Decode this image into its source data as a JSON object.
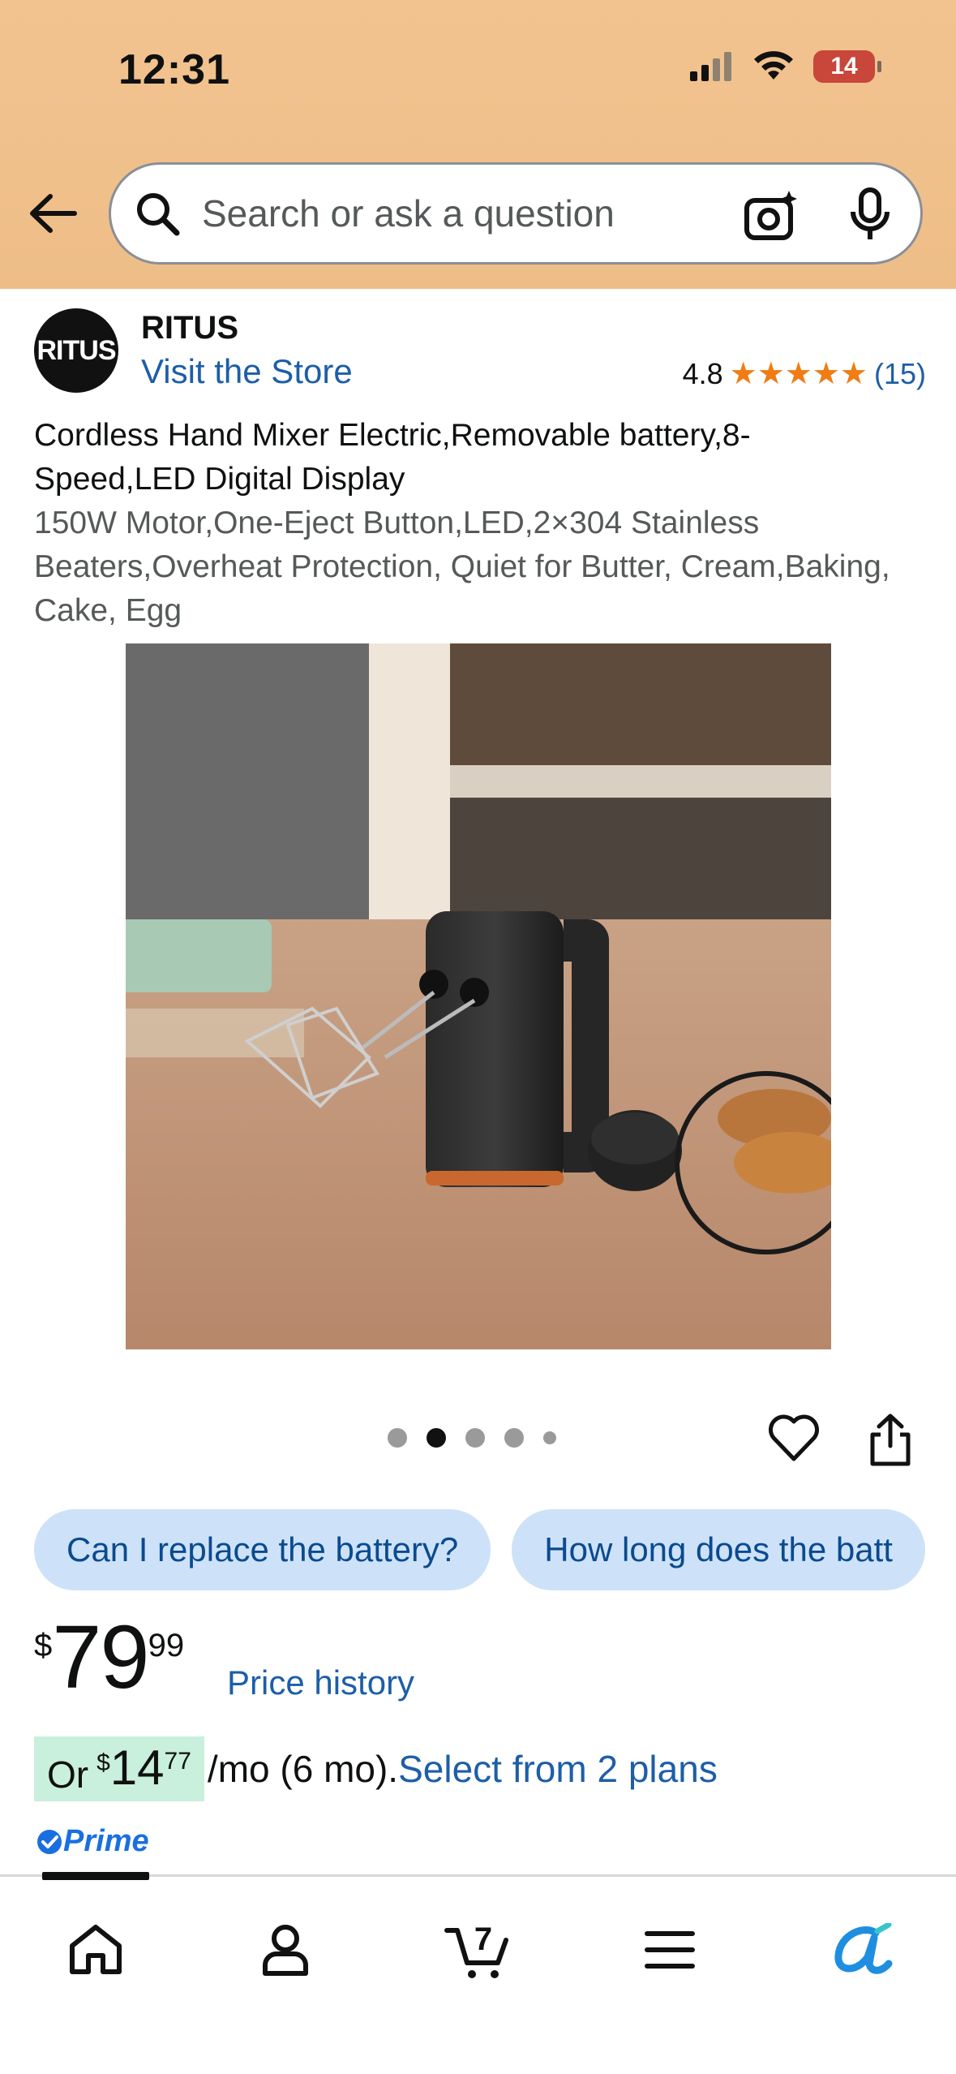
{
  "status_bar": {
    "time": "12:31",
    "battery": "14"
  },
  "search": {
    "placeholder": "Search or ask a question"
  },
  "store": {
    "logo_text": "RITUS",
    "brand": "RITUS",
    "visit_label": "Visit the Store",
    "rating": "4.8",
    "stars": "★★★★★",
    "review_count": "(15)"
  },
  "product": {
    "title": "Cordless Hand Mixer Electric,Removable battery,8-Speed,LED Digital Display",
    "subtitle": "150W Motor,One-Eject Button,LED,2×304 Stainless Beaters,Overheat Protection, Quiet for Butter, Cream,Baking, Cake, Egg",
    "image_count": 5,
    "active_image": 2
  },
  "chips": [
    {
      "label": "Can I replace the battery?"
    },
    {
      "label": "How long does the batt"
    }
  ],
  "price": {
    "symbol": "$",
    "whole": "79",
    "fraction": "99",
    "history_label": "Price history"
  },
  "installment": {
    "prefix": "Or",
    "symbol": "$",
    "whole": "14",
    "fraction": "77",
    "suffix": "/mo (6 mo).",
    "link_label": "Select from 2 plans"
  },
  "prime": {
    "label": "Prime"
  },
  "tabbar": {
    "cart_count": "7"
  },
  "colors": {
    "accent_link": "#1d5ea8",
    "header_bg": "#f2c38f",
    "star": "#f07c14",
    "chip_bg": "#cde2f8"
  }
}
